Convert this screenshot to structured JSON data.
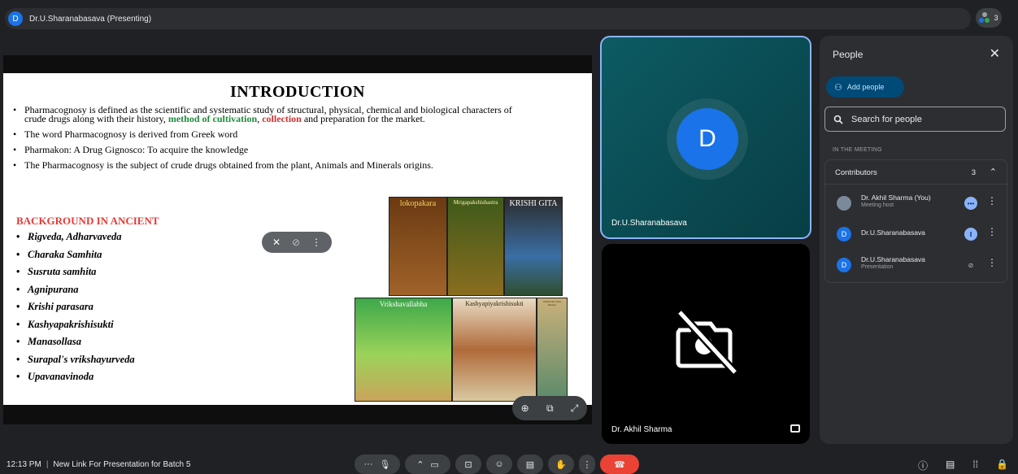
{
  "presenter_bar": {
    "avatar_letter": "D",
    "label": "Dr.U.Sharanabasava (Presenting)",
    "participant_count": "3"
  },
  "slide": {
    "title": "INTRODUCTION",
    "bullet1_a": "Pharmacognosy is defined as the scientific and systematic study of structural, physical, chemical and biological characters of crude drugs along with their history, ",
    "bullet1_green": "method of cultivation",
    "bullet1_comma": ", ",
    "bullet1_red": "collection",
    "bullet1_b": " and preparation for the market.",
    "bullet2": "The word Pharmacognosy is derived from Greek word",
    "bullet3": " Pharmakon: A Drug      Gignosco: To acquire the knowledge",
    "bullet4": "The Pharmacognosy is the subject of crude drugs obtained from the plant, Animals and Minerals origins.",
    "background_heading": "BACKGROUND IN ANCIENT",
    "ancient_texts": [
      "Rigveda, Adharvaveda",
      "Charaka Samhita",
      "Susruta samhita",
      "Agnipurana",
      "Krishi parasara",
      "Kashyapakrishisukti",
      "Manasollasa",
      "Surapal's vrikshayurveda",
      "Upavanavinoda"
    ],
    "books": [
      "lokopakara",
      "Mrigapakshishastra",
      "KRISHI GITA",
      "Vrikshavallabha",
      "Kashyapiyakrishisukti",
      "Vriksha Das Yaana Rahasya"
    ]
  },
  "tiles": {
    "tile1_avatar": "D",
    "tile1_name": "Dr.U.Sharanabasava",
    "tile2_name": "Dr. Akhil Sharma"
  },
  "people_panel": {
    "title": "People",
    "add_people": "Add people",
    "search_placeholder": "Search for people",
    "in_meeting": "IN THE MEETING",
    "contributors_label": "Contributors",
    "contributors_count": "3",
    "people": [
      {
        "name": "Dr. Akhil Sharma (You)",
        "sub": "Meeting host",
        "avatar": ""
      },
      {
        "name": "Dr.U.Sharanabasava",
        "sub": "",
        "avatar": "D"
      },
      {
        "name": "Dr.U.Sharanabasava",
        "sub": "Presentation",
        "avatar": "D"
      }
    ]
  },
  "bottom_bar": {
    "time": "12:13 PM",
    "meeting_title": "New Link For Presentation for Batch 5"
  },
  "colors": {
    "accent": "#8ab4f8",
    "end_call": "#ea4335",
    "avatar_blue": "#1a73e8",
    "tile_teal": "#0d5b63"
  }
}
